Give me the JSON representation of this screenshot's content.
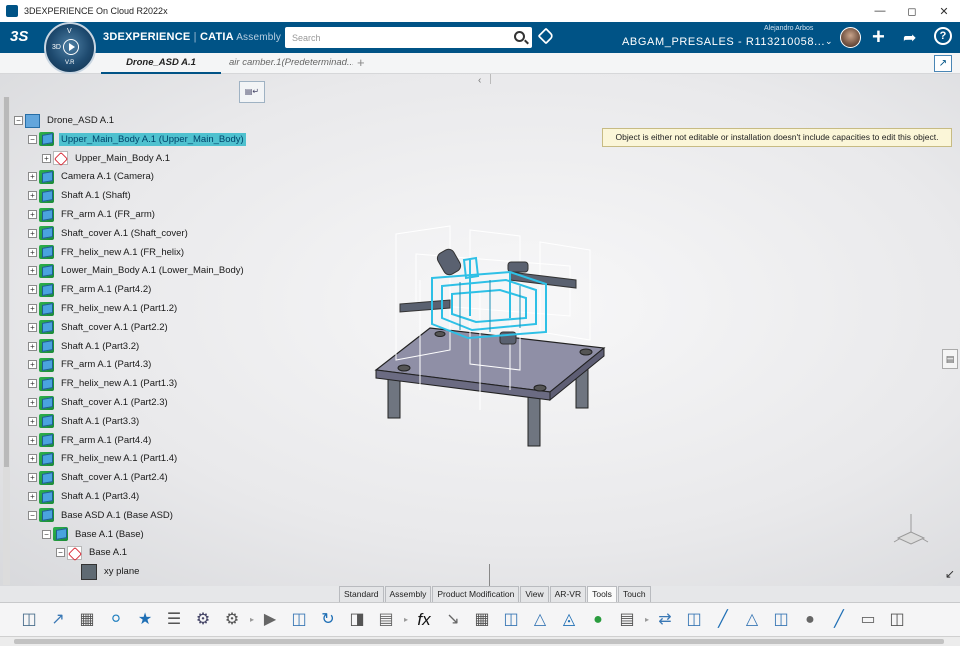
{
  "window": {
    "title": "3DEXPERIENCE On Cloud R2022x",
    "controls": [
      "minimize-icon",
      "maximize-icon",
      "close-icon"
    ]
  },
  "header": {
    "ds_logo": "3S",
    "compass": {
      "label_3d": "3D",
      "label_v": "V",
      "label_vr": "V.R"
    },
    "brand_bold": "3D",
    "brand_rest": "EXPERIENCE",
    "brand_sep": " | ",
    "brand_app": "CATIA",
    "brand_context": " Assembly ...",
    "search_placeholder": "Search",
    "user_name": "Alejandro Arbos",
    "tenant": "ABGAM_PRESALES - R113210058...",
    "accent": "#005386"
  },
  "tabs": [
    {
      "label": "Drone_ASD A.1",
      "active": true
    },
    {
      "label": "air camber.1(Predeterminad...",
      "active": false
    }
  ],
  "tree": {
    "nodes": [
      {
        "label": "Drone_ASD A.1",
        "icon": "root-product-icon",
        "expander": "−"
      },
      {
        "label": "Upper_Main_Body A.1 (Upper_Main_Body)",
        "icon": "assembly-icon",
        "expander": "−",
        "selected": true
      },
      {
        "label": "Upper_Main_Body A.1",
        "icon": "part-icon",
        "expander": "+"
      },
      {
        "label": "Camera A.1 (Camera)",
        "icon": "assembly-icon",
        "expander": "+"
      },
      {
        "label": "Shaft A.1 (Shaft)",
        "icon": "assembly-icon",
        "expander": "+"
      },
      {
        "label": "FR_arm A.1 (FR_arm)",
        "icon": "assembly-icon",
        "expander": "+"
      },
      {
        "label": "Shaft_cover A.1 (Shaft_cover)",
        "icon": "assembly-icon",
        "expander": "+"
      },
      {
        "label": "FR_helix_new A.1 (FR_helix)",
        "icon": "assembly-icon",
        "expander": "+"
      },
      {
        "label": "Lower_Main_Body A.1 (Lower_Main_Body)",
        "icon": "assembly-icon",
        "expander": "+"
      },
      {
        "label": "FR_arm A.1 (Part4.2)",
        "icon": "assembly-icon",
        "expander": "+"
      },
      {
        "label": "FR_helix_new A.1 (Part1.2)",
        "icon": "assembly-icon",
        "expander": "+"
      },
      {
        "label": "Shaft_cover A.1 (Part2.2)",
        "icon": "assembly-icon",
        "expander": "+"
      },
      {
        "label": "Shaft A.1 (Part3.2)",
        "icon": "assembly-icon",
        "expander": "+"
      },
      {
        "label": "FR_arm A.1 (Part4.3)",
        "icon": "assembly-icon",
        "expander": "+"
      },
      {
        "label": "FR_helix_new A.1 (Part1.3)",
        "icon": "assembly-icon",
        "expander": "+"
      },
      {
        "label": "Shaft_cover A.1 (Part2.3)",
        "icon": "assembly-icon",
        "expander": "+"
      },
      {
        "label": "Shaft A.1 (Part3.3)",
        "icon": "assembly-icon",
        "expander": "+"
      },
      {
        "label": "FR_arm A.1 (Part4.4)",
        "icon": "assembly-icon",
        "expander": "+"
      },
      {
        "label": "FR_helix_new A.1 (Part1.4)",
        "icon": "assembly-icon",
        "expander": "+"
      },
      {
        "label": "Shaft_cover A.1 (Part2.4)",
        "icon": "assembly-icon",
        "expander": "+"
      },
      {
        "label": "Shaft A.1 (Part3.4)",
        "icon": "assembly-icon",
        "expander": "+"
      },
      {
        "label": "Base ASD A.1 (Base ASD)",
        "icon": "assembly-icon",
        "expander": "−"
      },
      {
        "label": "Base A.1 (Base)",
        "icon": "assembly-icon",
        "expander": "−"
      },
      {
        "label": "Base A.1",
        "icon": "part-icon",
        "expander": "−"
      },
      {
        "label": "xy plane",
        "icon": "plane-icon",
        "expander": ""
      }
    ]
  },
  "info_message": "Object is either not editable or installation doesn't include capacities to edit this object.",
  "action_bar": {
    "tabs": [
      "Standard",
      "Assembly",
      "Product Modification",
      "View",
      "AR-VR",
      "Tools",
      "Touch"
    ],
    "active_tab": "Tools",
    "tools": [
      "export-icon",
      "select-icon",
      "properties-icon",
      "3d-search-icon",
      "favorites-star-icon",
      "list-icon",
      "tree-icon",
      "settings-icon",
      "open-icon",
      "repository-icon",
      "refresh-icon",
      "relations-icon",
      "save-icon",
      "formula-fx-icon",
      "sketch-icon",
      "table-icon",
      "import-icon",
      "publish-icon",
      "measure-icon",
      "traffic-light-icon",
      "data-icon",
      "replace-icon",
      "snap-icon",
      "ruler-icon",
      "probe-icon",
      "compare-icon",
      "shading-icon",
      "color-picker-icon",
      "eraser-icon",
      "render-icon"
    ]
  }
}
